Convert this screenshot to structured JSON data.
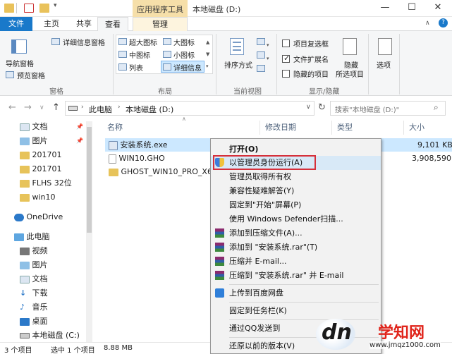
{
  "window": {
    "title": "本地磁盘 (D:)",
    "context_title": "应用程序工具",
    "controls": [
      "—",
      "☐",
      "✕"
    ]
  },
  "tabs": {
    "file": "文件",
    "home": "主页",
    "share": "共享",
    "view": "查看",
    "manage": "管理"
  },
  "ribbon": {
    "panes": {
      "nav_pane": "导航窗格",
      "preview_pane": "预览窗格",
      "details_pane": "详细信息窗格",
      "group": "窗格"
    },
    "layout": {
      "items": [
        "超大图标",
        "大图标",
        "中图标",
        "小图标",
        "列表",
        "详细信息"
      ],
      "group": "布局"
    },
    "current_view": {
      "sort_by": "排序方式",
      "group": "当前视图"
    },
    "show_hide": {
      "item_checkboxes": "项目复选框",
      "file_extensions": "文件扩展名",
      "hidden_items": "隐藏的项目",
      "hide_selected": [
        "隐藏",
        "所选项目"
      ],
      "options": "选项",
      "group": "显示/隐藏"
    }
  },
  "address": {
    "back": "←",
    "forward": "→",
    "recent": "∨",
    "up": "↑",
    "crumbs": [
      "此电脑",
      "本地磁盘 (D:)"
    ],
    "search_placeholder": "搜索\"本地磁盘 (D:)\""
  },
  "nav_items": [
    {
      "label": "文档",
      "pinned": "📌"
    },
    {
      "label": "图片",
      "pinned": "📌"
    },
    {
      "label": "201701"
    },
    {
      "label": "201701"
    },
    {
      "label": "FLHS 32位"
    },
    {
      "label": "win10"
    },
    {
      "label": "OneDrive"
    },
    {
      "label": "此电脑"
    },
    {
      "label": "视频"
    },
    {
      "label": "图片"
    },
    {
      "label": "文档"
    },
    {
      "label": "下载"
    },
    {
      "label": "音乐"
    },
    {
      "label": "桌面"
    },
    {
      "label": "本地磁盘 (C:)"
    }
  ],
  "columns": {
    "name": "名称",
    "modified": "修改日期",
    "type": "类型",
    "size": "大小"
  },
  "files": [
    {
      "name": "安装系统.exe",
      "size": "9,101 KB"
    },
    {
      "name": "WIN10.GHO",
      "size": "3,908,590..."
    },
    {
      "name": "GHOST_WIN10_PRO_X64_"
    }
  ],
  "status": {
    "count": "3 个项目",
    "selected": "选中 1 个项目",
    "size": "8.88 MB"
  },
  "context_menu": [
    {
      "label": "打开(O)"
    },
    {
      "label": "以管理员身份运行(A)"
    },
    {
      "label": "管理员取得所有权"
    },
    {
      "label": "兼容性疑难解答(Y)"
    },
    {
      "label": "固定到\"开始\"屏幕(P)"
    },
    {
      "label": "使用 Windows Defender扫描..."
    },
    {
      "label": "添加到压缩文件(A)..."
    },
    {
      "label": "添加到 \"安装系统.rar\"(T)"
    },
    {
      "label": "压缩并 E-mail..."
    },
    {
      "label": "压缩到 \"安装系统.rar\" 并 E-mail"
    },
    {
      "label": "上传到百度网盘"
    },
    {
      "label": "固定到任务栏(K)"
    },
    {
      "label": "通过QQ发送到"
    },
    {
      "label": "还原以前的版本(V)"
    }
  ],
  "watermark": {
    "logo": "dn",
    "brand": "学知网",
    "url": "www.jmqz1000.com"
  },
  "colors": {
    "accent": "#1979ca",
    "context_tab": "#f6dfa9",
    "selection": "#cce8ff",
    "highlight_box": "#d6303a"
  }
}
